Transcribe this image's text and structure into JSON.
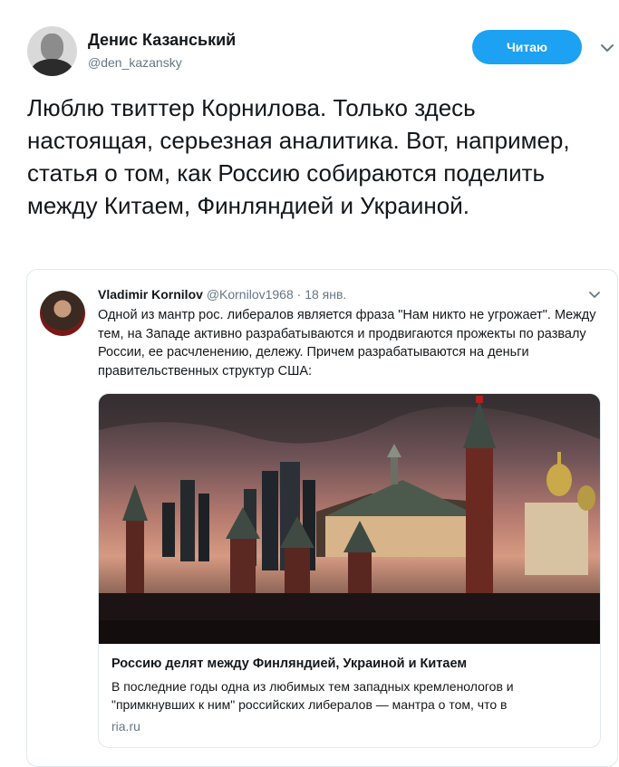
{
  "tweet": {
    "author_name": "Денис Казанський",
    "author_handle": "@den_kazansky",
    "follow_label": "Читаю",
    "text": "Люблю твиттер Корнилова. Только здесь настоящая, серьезная аналитика. Вот, например, статья о том, как Россию собираются поделить между Китаем, Финляндией и Украиной."
  },
  "quoted": {
    "author_name": "Vladimir Kornilov",
    "author_handle": "@Kornilov1968",
    "separator": "·",
    "date": "18 янв.",
    "text": "Одной из мантр рос. либералов является фраза \"Нам никто не угрожает\". Между тем, на Западе активно разрабатываются и продвигаются прожекты по развалу России, ее расчленению, дележу. Причем разрабатываются на деньги правительственных структур США:",
    "link_card": {
      "title": "Россию делят между Финляндией, Украиной и Китаем",
      "description": "В последние годы одна из любимых тем западных кремленологов и \"примкнувших к ним\" российских либералов — мантра о том, что в",
      "domain": "ria.ru"
    }
  },
  "colors": {
    "accent": "#1da1f2",
    "muted_text": "#657786",
    "border": "#e1e8ed"
  },
  "icons": [
    "chevron-down-icon"
  ]
}
